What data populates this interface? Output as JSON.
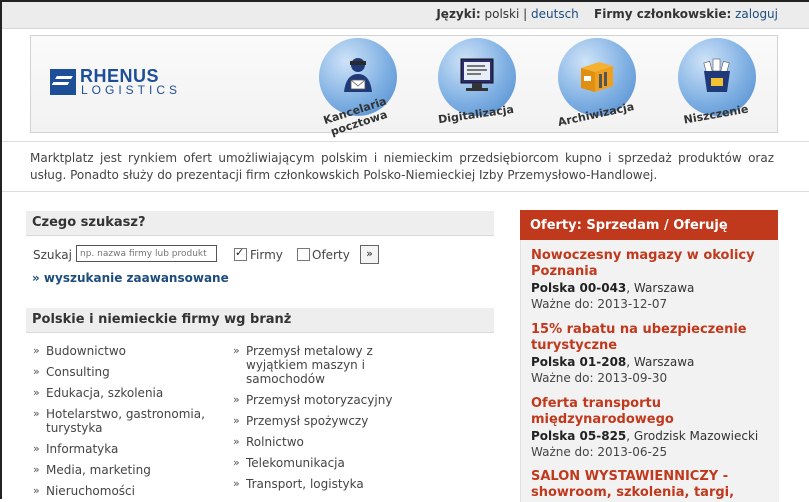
{
  "topbar": {
    "lang_label": "Języki:",
    "lang_current": "polski",
    "lang_sep": "|",
    "lang_other": "deutsch",
    "members_label": "Firmy członkowskie:",
    "login": "zaloguj"
  },
  "banner": {
    "logo_top": "RHENUS",
    "logo_bottom": "LOGISTICS",
    "services": [
      {
        "label": "Kancelaria pocztowa",
        "icon": "postman-icon"
      },
      {
        "label": "Digitalizacja",
        "icon": "monitor-icon"
      },
      {
        "label": "Archiwizacja",
        "icon": "archive-box-icon"
      },
      {
        "label": "Niszczenie",
        "icon": "shredder-icon"
      }
    ]
  },
  "intro": "Marktplatz jest rynkiem ofert umożliwiającym polskim i niemieckim przedsiębiorcom kupno i sprzedaż produktów oraz usług. Ponadto służy do prezentacji firm członkowskich Polsko-Niemieckiej Izby Przemysłowo-Handlowej.",
  "search": {
    "heading": "Czego szukasz?",
    "label": "Szukaj",
    "placeholder": "np. nazwa firmy lub produkt",
    "check_firms": "Firmy",
    "check_firms_checked": true,
    "check_offers": "Oferty",
    "check_offers_checked": false,
    "go": "»",
    "advanced": "» wyszukanie zaawansowane"
  },
  "industries": {
    "heading": "Polskie i niemieckie firmy wg branż",
    "col1": [
      "Budownictwo",
      "Consulting",
      "Edukacja, szkolenia",
      "Hotelarstwo, gastronomia, turystyka",
      "Informatyka",
      "Media, marketing",
      "Nieruchomości"
    ],
    "col2": [
      "Przemysł metalowy z wyjątkiem maszyn i samochodów",
      "Przemysł motoryzacyjny",
      "Przemysł spożywczy",
      "Rolnictwo",
      "Telekomunikacja",
      "Transport, logistyka"
    ]
  },
  "offers": {
    "heading": "Oferty: Sprzedam / Oferuję",
    "items": [
      {
        "title": "Nowoczesny magazy w okolicy Poznania",
        "code": "Polska 00-043",
        "city": ", Warszawa",
        "valid": "Ważne do: 2013-12-07"
      },
      {
        "title": "15% rabatu na ubezpieczenie turystyczne",
        "code": "Polska 01-208",
        "city": ", Warszawa",
        "valid": "Ważne do: 2013-09-30"
      },
      {
        "title": "Oferta transportu międzynarodowego",
        "code": "Polska 05-825",
        "city": ", Grodzisk Mazowiecki",
        "valid": "Ważne do: 2013-06-25"
      },
      {
        "title": "SALON WYSTAWIENNICZY - showroom, szkolenia, targi,",
        "code": "",
        "city": "",
        "valid": ""
      }
    ]
  },
  "colors": {
    "accent": "#c1391d",
    "link": "#1d4d7d",
    "brand": "#1c4f97"
  }
}
